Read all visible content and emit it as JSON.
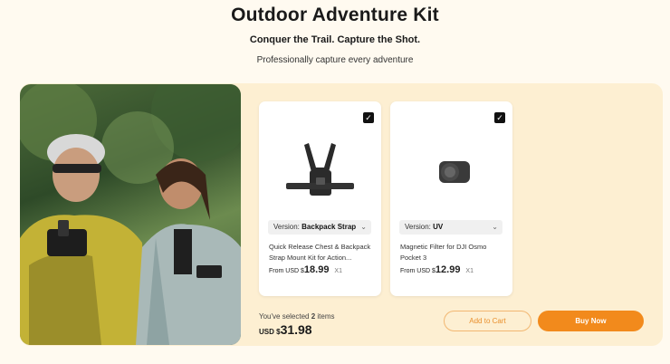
{
  "header": {
    "title": "Outdoor Adventure Kit",
    "subtitle": "Conquer the Trail. Capture the Shot.",
    "tagline": "Professionally capture every adventure"
  },
  "products": [
    {
      "checked_icon": "check-icon",
      "version_label": "Version: ",
      "version_value": "Backpack Strap",
      "name": "Quick Release Chest & Backpack Strap Mount Kit for Action...",
      "price_prefix": "From",
      "currency": "USD $",
      "price": "18.99",
      "qty": "X1"
    },
    {
      "checked_icon": "check-icon",
      "version_label": "Version: ",
      "version_value": "UV",
      "name": "Magnetic Filter for DJI Osmo Pocket 3",
      "price_prefix": "From",
      "currency": "USD $",
      "price": "12.99",
      "qty": "X1"
    }
  ],
  "summary": {
    "selected_prefix": "You've selected ",
    "selected_count": "2",
    "selected_suffix": " items",
    "currency": "USD $",
    "total": "31.98"
  },
  "buttons": {
    "add_to_cart": "Add to Cart",
    "buy_now": "Buy Now"
  },
  "colors": {
    "accent": "#f28a1c",
    "panel": "#fdefd2",
    "page": "#fffaf0"
  }
}
